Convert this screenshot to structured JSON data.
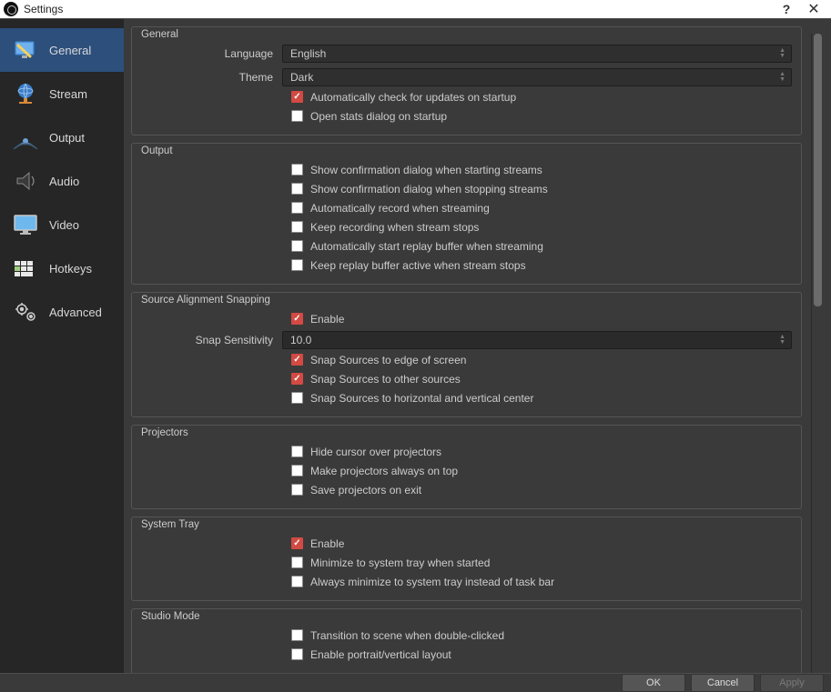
{
  "window": {
    "title": "Settings"
  },
  "sidebar": {
    "items": [
      {
        "label": "General"
      },
      {
        "label": "Stream"
      },
      {
        "label": "Output"
      },
      {
        "label": "Audio"
      },
      {
        "label": "Video"
      },
      {
        "label": "Hotkeys"
      },
      {
        "label": "Advanced"
      }
    ]
  },
  "groups": {
    "general": {
      "title": "General",
      "language_label": "Language",
      "language_value": "English",
      "theme_label": "Theme",
      "theme_value": "Dark",
      "chk_updates": "Automatically check for updates on startup",
      "chk_stats": "Open stats dialog on startup"
    },
    "output": {
      "title": "Output",
      "chk_start_confirm": "Show confirmation dialog when starting streams",
      "chk_stop_confirm": "Show confirmation dialog when stopping streams",
      "chk_auto_record": "Automatically record when streaming",
      "chk_keep_record": "Keep recording when stream stops",
      "chk_auto_replay": "Automatically start replay buffer when streaming",
      "chk_keep_replay": "Keep replay buffer active when stream stops"
    },
    "snapping": {
      "title": "Source Alignment Snapping",
      "chk_enable": "Enable",
      "sensitivity_label": "Snap Sensitivity",
      "sensitivity_value": "10.0",
      "chk_edge": "Snap Sources to edge of screen",
      "chk_other": "Snap Sources to other sources",
      "chk_center": "Snap Sources to horizontal and vertical center"
    },
    "projectors": {
      "title": "Projectors",
      "chk_hide_cursor": "Hide cursor over projectors",
      "chk_on_top": "Make projectors always on top",
      "chk_save": "Save projectors on exit"
    },
    "systray": {
      "title": "System Tray",
      "chk_enable": "Enable",
      "chk_min_start": "Minimize to system tray when started",
      "chk_always_min": "Always minimize to system tray instead of task bar"
    },
    "studio": {
      "title": "Studio Mode",
      "chk_dblclick": "Transition to scene when double-clicked",
      "chk_portrait": "Enable portrait/vertical layout"
    }
  },
  "footer": {
    "ok": "OK",
    "cancel": "Cancel",
    "apply": "Apply"
  }
}
